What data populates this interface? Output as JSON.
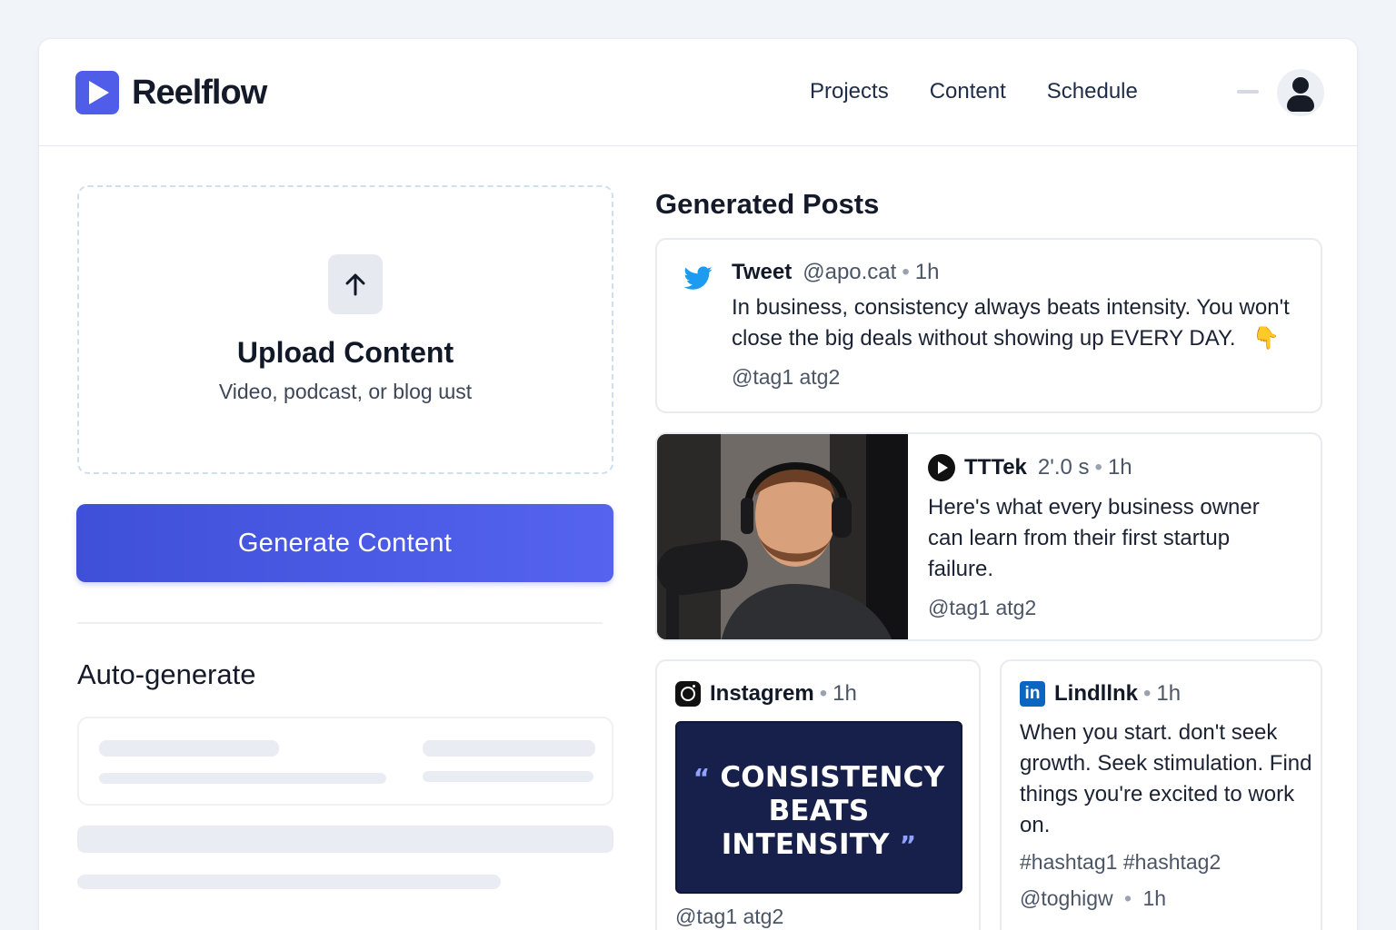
{
  "app": {
    "name": "Reelflow",
    "nav": [
      "Projects",
      "Content",
      "Schedule"
    ]
  },
  "upload": {
    "title": "Upload Content",
    "subtitle": "Video, podcast, or blog ɯst",
    "icon": "arrow-up-icon"
  },
  "generate_button": "Generate Content",
  "auto_generate": {
    "title": "Auto-generate"
  },
  "generated_posts": {
    "title": "Generated Posts",
    "tweet": {
      "platform": "Tweet",
      "handle": "@apo.cat",
      "time": "1h",
      "text": "In business, consistency always beats intensity. You won't close the big deals without showing up EVERY DAY.",
      "emoji": "👇",
      "tags": "@tag1  atg2"
    },
    "tiktok": {
      "platform": "TTTek",
      "duration": "2'.0 s",
      "time": "1h",
      "text": "Here's what every business owner can learn from their first startup failure.",
      "tags": "@tag1  atg2"
    },
    "instagram": {
      "platform": "Instagrem",
      "time": "1h",
      "quote_open": "“",
      "quote_close": "”",
      "quote_lines": [
        "CONSISTENCY",
        "BEATS",
        "INTENSITY"
      ],
      "tags": "@tag1  atg2"
    },
    "linkedin": {
      "platform": "Lindllnk",
      "icon_text": "in",
      "time": "1h",
      "text": "When you start. don't seek growth. Seek stimulation. Find things you're excited to work on.",
      "hashtags": "#hashtag1 #hashtag2",
      "handle": "@toghigw",
      "handle_time": "1h"
    }
  },
  "colors": {
    "accent": "#4f5de8",
    "twitter": "#1d9bf0",
    "linkedin": "#0b66c2",
    "quote_bg": "#17204a"
  }
}
